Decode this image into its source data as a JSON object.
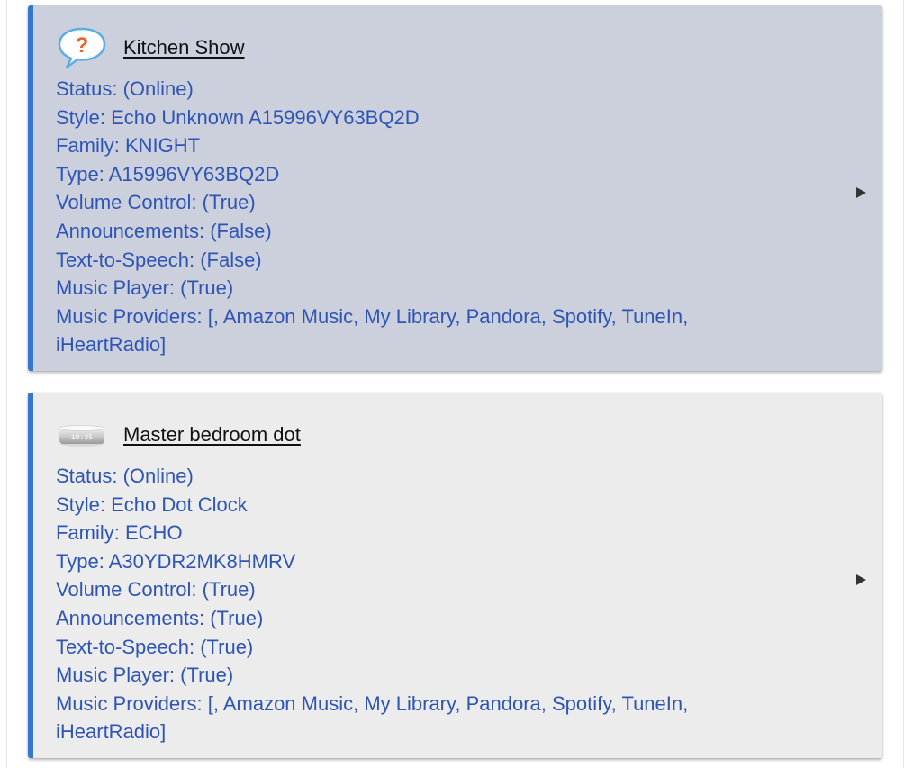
{
  "devices": [
    {
      "name": "Kitchen Show",
      "icon": "unknown-device-icon",
      "status": "Status: (Online)",
      "style": "Style: Echo Unknown A15996VY63BQ2D",
      "family": "Family: KNIGHT",
      "type": "Type: A15996VY63BQ2D",
      "volume_control": "Volume Control: (True)",
      "announcements": "Announcements: (False)",
      "tts": "Text-to-Speech: (False)",
      "music_player": "Music Player: (True)",
      "music_providers": "Music Providers: [, Amazon Music, My Library, Pandora, Spotify, TuneIn, iHeartRadio]",
      "background": "#ccd0dd"
    },
    {
      "name": "Master bedroom dot",
      "icon": "echo-dot-clock-icon",
      "clock_text": "10:35",
      "status": "Status: (Online)",
      "style": "Style: Echo Dot Clock",
      "family": "Family: ECHO",
      "type": "Type: A30YDR2MK8HMRV",
      "volume_control": "Volume Control: (True)",
      "announcements": "Announcements: (True)",
      "tts": "Text-to-Speech: (True)",
      "music_player": "Music Player: (True)",
      "music_providers": "Music Providers: [, Amazon Music, My Library, Pandora, Spotify, TuneIn, iHeartRadio]",
      "background": "#ececec"
    }
  ],
  "colors": {
    "accent_border": "#3577cc",
    "property_text": "#2e55b5",
    "icon_bubble": "#5aaee5",
    "icon_question": "#e8662e"
  }
}
